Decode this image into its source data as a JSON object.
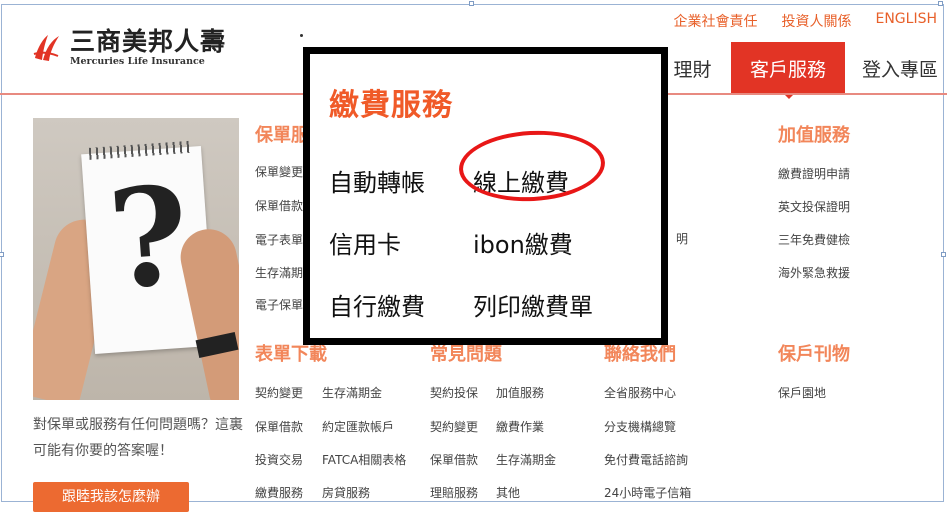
{
  "top_links": [
    "企業社會責任",
    "投資人關係",
    "ENGLISH"
  ],
  "logo": {
    "cn": "三商美邦人壽",
    "en": "Mercuries Life Insurance"
  },
  "nav": {
    "wealth": "理財",
    "service": "客戶服務",
    "login": "登入專區"
  },
  "hero": {
    "question": "對保單或服務有任何問題嗎？這裏可能有你要的答案喔！",
    "button": "跟睦我該怎麼辦"
  },
  "columns": {
    "policy_service": {
      "title": "保單服",
      "links": [
        "保單變更",
        "保單借款",
        "電子表單",
        "生存滿期",
        "電子保單"
      ]
    },
    "forms": {
      "title": "表單下載",
      "links": [
        "契約變更",
        "生存滿期金",
        "保單借款",
        "約定匯款帳戶",
        "投資交易",
        "FATCA相關表格",
        "繳費服務",
        "房貸服務"
      ]
    },
    "faq": {
      "title": "常見問題",
      "links": [
        "契約投保",
        "加值服務",
        "契約變更",
        "繳費作業",
        "保單借款",
        "生存滿期金",
        "理賠服務",
        "其他"
      ]
    },
    "contact": {
      "title": "聯絡我們",
      "links": [
        "全省服務中心",
        "分支機構總覽",
        "免付費電話諮詢",
        "24小時電子信箱"
      ],
      "partial": "明"
    },
    "value_added": {
      "title": "加值服務",
      "links": [
        "繳費證明申請",
        "英文投保證明",
        "三年免費健檢",
        "海外緊急救援"
      ]
    },
    "publications": {
      "title": "保戶刊物",
      "links": [
        "保戶園地"
      ]
    }
  },
  "popup": {
    "title": "繳費服務",
    "items": [
      "自動轉帳",
      "線上繳費",
      "信用卡",
      "ibon繳費",
      "自行繳費",
      "列印繳費單"
    ],
    "highlighted_item": "線上繳費"
  },
  "colors": {
    "brand_red": "#e23425",
    "accent_orange": "#f05a28",
    "highlight_circle": "#e81717"
  },
  "icons": [
    "mercuries-logo-icon",
    "question-mark-image"
  ]
}
